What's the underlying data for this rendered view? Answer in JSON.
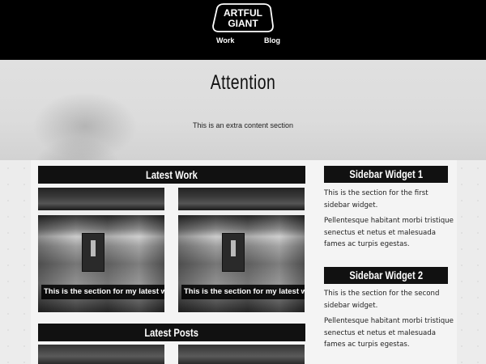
{
  "header": {
    "logo_line1": "ARTFUL",
    "logo_line2": "GIANT",
    "nav": [
      {
        "label": "Work"
      },
      {
        "label": "Blog"
      }
    ]
  },
  "hero": {
    "title": "Attention",
    "text": "This is an extra content section"
  },
  "main": {
    "latest_work": {
      "title": "Latest Work",
      "items": [
        {
          "caption": "This is the section for my latest work"
        },
        {
          "caption": "This is the section for my latest work"
        }
      ]
    },
    "latest_posts": {
      "title": "Latest Posts"
    }
  },
  "sidebar": {
    "widgets": [
      {
        "title": "Sidebar Widget 1",
        "text1": "This is the section for the first sidebar widget.",
        "text2": "Pellentesque habitant morbi tristique senectus et netus et malesuada fames ac turpis egestas."
      },
      {
        "title": "Sidebar Widget 2",
        "text1": "This is the section for the second sidebar widget.",
        "text2": "Pellentesque habitant morbi tristique senectus et netus et malesuada fames ac turpis egestas."
      }
    ]
  },
  "colors": {
    "header_bg": "#000000",
    "bar_bg": "#111111",
    "page_bg": "#ececec"
  }
}
